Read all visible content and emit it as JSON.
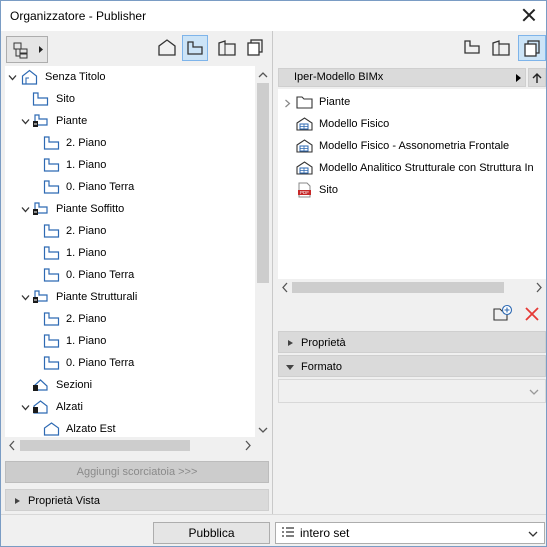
{
  "window": {
    "title": "Organizzatore - Publisher"
  },
  "left_toolbar": {
    "buttons": [
      "folder-tree-dropdown",
      "view-map",
      "layout-book",
      "publisher-sets"
    ],
    "selected": "layout-book"
  },
  "tree": {
    "items": [
      {
        "label": "Senza Titolo",
        "level": 0,
        "icon": "project-icon",
        "expanded": true
      },
      {
        "label": "Sito",
        "level": 1,
        "icon": "story-icon"
      },
      {
        "label": "Piante",
        "level": 1,
        "icon": "floor-plans-icon",
        "expanded": true
      },
      {
        "label": "2. Piano",
        "level": 2,
        "icon": "story-icon"
      },
      {
        "label": "1. Piano",
        "level": 2,
        "icon": "story-icon"
      },
      {
        "label": "0. Piano Terra",
        "level": 2,
        "icon": "story-icon"
      },
      {
        "label": "Piante Soffitto",
        "level": 1,
        "icon": "floor-plans-icon",
        "expanded": true
      },
      {
        "label": "2. Piano",
        "level": 2,
        "icon": "story-icon"
      },
      {
        "label": "1. Piano",
        "level": 2,
        "icon": "story-icon"
      },
      {
        "label": "0. Piano Terra",
        "level": 2,
        "icon": "story-icon"
      },
      {
        "label": "Piante Strutturali",
        "level": 1,
        "icon": "floor-plans-icon",
        "expanded": true
      },
      {
        "label": "2. Piano",
        "level": 2,
        "icon": "story-icon"
      },
      {
        "label": "1. Piano",
        "level": 2,
        "icon": "story-icon"
      },
      {
        "label": "0. Piano Terra",
        "level": 2,
        "icon": "story-icon"
      },
      {
        "label": "Sezioni",
        "level": 1,
        "icon": "sections-icon"
      },
      {
        "label": "Alzati",
        "level": 1,
        "icon": "elevations-icon",
        "expanded": true
      },
      {
        "label": "Alzato Est",
        "level": 2,
        "icon": "elevation-icon"
      }
    ]
  },
  "left_bottom": {
    "shortcut_button": "Aggiungi scorciatoia >>>",
    "view_props": "Proprietà Vista"
  },
  "right_toolbar": {
    "buttons": [
      "view-map",
      "layout-book",
      "publisher-sets"
    ],
    "selected": "publisher-sets"
  },
  "publisher": {
    "set_name": "Iper-Modello BIMx",
    "items": [
      {
        "label": "Piante",
        "icon": "folder-icon",
        "expandable": true
      },
      {
        "label": "Modello Fisico",
        "icon": "model-3d-icon"
      },
      {
        "label": "Modello Fisico - Assonometria Frontale",
        "icon": "model-3d-icon"
      },
      {
        "label": "Modello Analitico Strutturale con Struttura In",
        "icon": "model-3d-icon"
      },
      {
        "label": "Sito",
        "icon": "pdf-icon"
      }
    ]
  },
  "right_panels": {
    "properties": "Proprietà",
    "format": "Formato"
  },
  "bottom": {
    "publish_button": "Pubblica",
    "set_select": "intero set"
  },
  "colors": {
    "selection": "#cce4f7",
    "icon_blue": "#2e6ab3",
    "pdf_red": "#c62828",
    "delete_red": "#e53935"
  }
}
